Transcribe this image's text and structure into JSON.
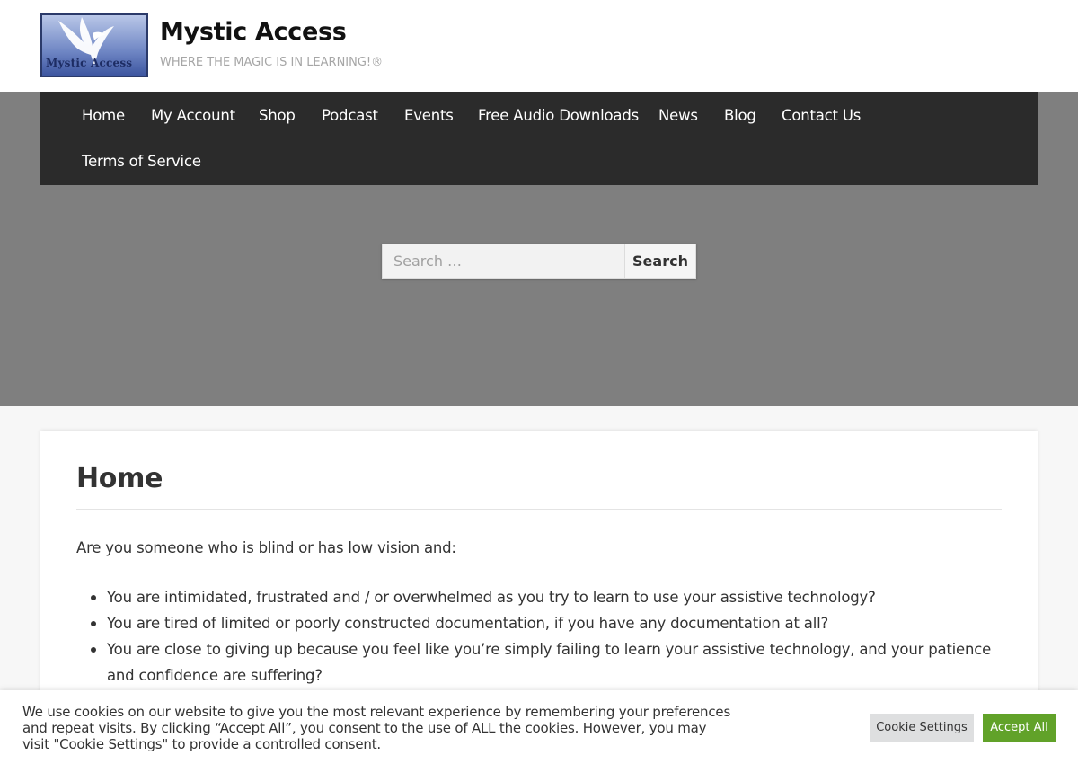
{
  "site": {
    "logo_text": "Mystic Access",
    "title": "Mystic Access",
    "tagline": "WHERE THE MAGIC IS IN LEARNING!®"
  },
  "nav": {
    "items": [
      {
        "label": "Home"
      },
      {
        "label": "My Account"
      },
      {
        "label": "Shop"
      },
      {
        "label": "Podcast"
      },
      {
        "label": "Events"
      },
      {
        "label": "Free Audio Downloads"
      },
      {
        "label": "News"
      },
      {
        "label": "Blog"
      },
      {
        "label": "Contact Us"
      },
      {
        "label": "Terms of Service"
      }
    ]
  },
  "search": {
    "placeholder": "Search …",
    "value": "",
    "button_label": "Search"
  },
  "main": {
    "title": "Home",
    "intro": "Are you someone who is blind or has low vision and:",
    "bullets": [
      "You are intimidated, frustrated and / or overwhelmed as you try to learn to use your assistive technology?",
      "You are tired of limited or poorly constructed documentation, if you have any documentation at all?",
      "You are close to giving up because you feel like you’re simply failing to learn your assistive technology, and your patience and confidence are suffering?"
    ]
  },
  "cookie": {
    "text": "We use cookies on our website to give you the most relevant experience by remembering your preferences and repeat visits. By clicking “Accept All”, you consent to the use of ALL the cookies. However, you may visit \"Cookie Settings\" to provide a controlled consent.",
    "settings_label": "Cookie Settings",
    "accept_label": "Accept All"
  },
  "colors": {
    "nav_background": "#2b2b2b",
    "hero_background": "#7f7f7f",
    "accept_button": "#61a229"
  }
}
